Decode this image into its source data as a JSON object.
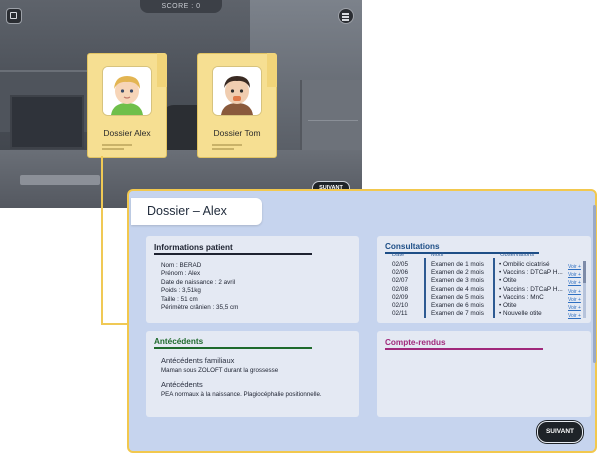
{
  "hud": {
    "score_label": "SCORE : 0"
  },
  "folders": [
    {
      "label": "Dossier Alex"
    },
    {
      "label": "Dossier Tom"
    }
  ],
  "background_next_label": "SUIVANT",
  "panel": {
    "title": "Dossier – Alex",
    "info": {
      "heading": "Informations patient",
      "rows": [
        "Nom : BERAD",
        "Prénom : Alex",
        "Date de naissance : 2 avril",
        "Poids : 3,51kg",
        "Taille : 51 cm",
        "Périmètre crânien : 35,5 cm"
      ]
    },
    "consultations": {
      "heading": "Consultations",
      "columns": [
        "Date",
        "Motif",
        "Observations"
      ],
      "rows": [
        {
          "date": "02/05",
          "motif": "Examen de 1 mois",
          "obs": "• Ombilic cicatrisé",
          "link": "Voir +"
        },
        {
          "date": "02/06",
          "motif": "Examen de 2 mois",
          "obs": "• Vaccins : DTCaP H...",
          "link": "Voir +"
        },
        {
          "date": "02/07",
          "motif": "Examen de 3 mois",
          "obs": "• Otite",
          "link": "Voir +"
        },
        {
          "date": "02/08",
          "motif": "Examen de 4 mois",
          "obs": "• Vaccins : DTCaP H...",
          "link": "Voir +"
        },
        {
          "date": "02/09",
          "motif": "Examen de 5 mois",
          "obs": "• Vaccins : MnC",
          "link": "Voir +"
        },
        {
          "date": "02/10",
          "motif": "Examen de 6 mois",
          "obs": "• Otite",
          "link": "Voir +"
        },
        {
          "date": "02/11",
          "motif": "Examen de 7 mois",
          "obs": "• Nouvelle otite",
          "link": "Voir +"
        }
      ]
    },
    "antecedents": {
      "heading": "Antécédents",
      "family_label": "Antécédents familiaux",
      "family_text": "Maman sous ZOLOFT durant la grossesse",
      "personal_label": "Antécédents",
      "personal_text": "PEA normaux à la naissance. Plagiocéphalie positionnelle."
    },
    "reports": {
      "heading": "Compte-rendus"
    },
    "next_label": "SUIVANT"
  },
  "colors": {
    "folder": "#f6df92",
    "panel_bg": "#c6d4ee",
    "panel_border": "#f2c84e",
    "info_accent": "#1d2230",
    "consult_accent": "#1d4e86",
    "ante_accent": "#1e6a2c",
    "reports_accent": "#a0287b"
  }
}
